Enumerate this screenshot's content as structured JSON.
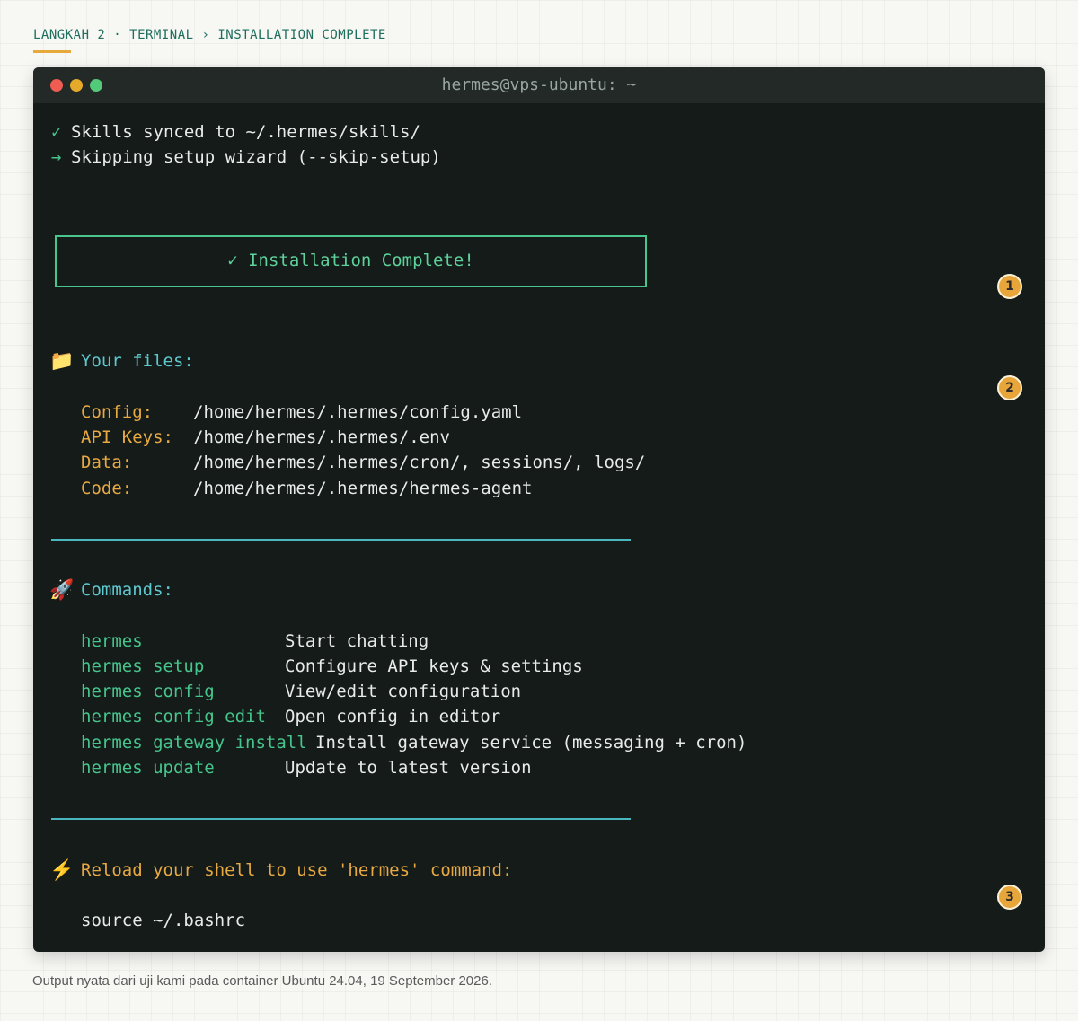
{
  "breadcrumb": "LANGKAH 2 · TERMINAL › INSTALLATION COMPLETE",
  "terminal": {
    "title": "hermes@vps-ubuntu: ~",
    "lines": [
      {
        "glyph": "✓",
        "text": "Skills synced to ~/.hermes/skills/"
      },
      {
        "glyph": "→",
        "text": "Skipping setup wizard (--skip-setup)"
      }
    ],
    "banner": "✓ Installation Complete!",
    "files_heading": "Your files:",
    "files": [
      {
        "label": "Config:",
        "path": "/home/hermes/.hermes/config.yaml"
      },
      {
        "label": "API Keys:",
        "path": "/home/hermes/.hermes/.env"
      },
      {
        "label": "Data:",
        "path": "/home/hermes/.hermes/cron/, sessions/, logs/"
      },
      {
        "label": "Code:",
        "path": "/home/hermes/.hermes/hermes-agent"
      }
    ],
    "commands_heading": "Commands:",
    "commands": [
      {
        "cmd": "hermes",
        "desc": "Start chatting"
      },
      {
        "cmd": "hermes setup",
        "desc": "Configure API keys & settings"
      },
      {
        "cmd": "hermes config",
        "desc": "View/edit configuration"
      },
      {
        "cmd": "hermes config edit",
        "desc": "Open config in editor"
      },
      {
        "cmd": "hermes gateway install",
        "desc": "Install gateway service (messaging + cron)"
      },
      {
        "cmd": "hermes update",
        "desc": "Update to latest version"
      }
    ],
    "reload_heading": "Reload your shell to use 'hermes' command:",
    "reload_command": "source ~/.bashrc"
  },
  "icons": {
    "files": "folder-icon",
    "commands": "rocket-icon",
    "reload": "lightning-icon"
  },
  "markers": [
    "1",
    "2",
    "3"
  ],
  "caption": "Output nyata dari uji kami pada container Ubuntu 24.04, 19 September 2026.",
  "colors": {
    "terminal_bg": "#141b19",
    "green": "#46c58c",
    "cyan": "#5ec8cf",
    "amber": "#e8a943",
    "marker": "#e8a63a"
  }
}
